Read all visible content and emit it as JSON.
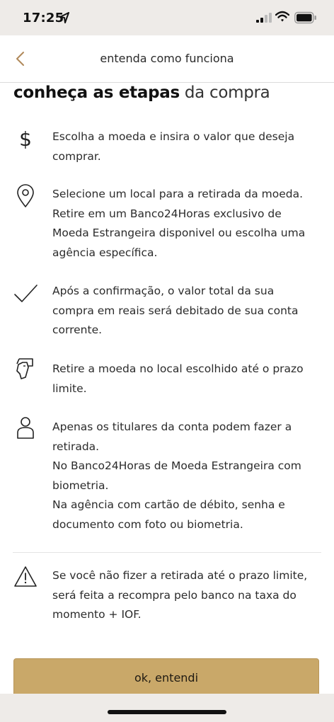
{
  "status_bar": {
    "time": "17:25"
  },
  "nav": {
    "title": "entenda como funciona"
  },
  "heading": {
    "bold": "conheça as etapas",
    "light": "da compra"
  },
  "steps": [
    {
      "icon": "dollar-icon",
      "lines": [
        "Escolha a moeda e insira o valor que deseja",
        "comprar."
      ]
    },
    {
      "icon": "location-pin-icon",
      "lines": [
        "Selecione um local para a retirada da moeda.",
        "Retire em um Banco24Horas exclusivo de",
        "Moeda Estrangeira disponivel ou escolha uma",
        "agência específica."
      ]
    },
    {
      "icon": "checkmark-icon",
      "lines": [
        "Após a confirmação, o valor total da sua",
        "compra em reais será debitado de sua conta",
        "corrente."
      ]
    },
    {
      "icon": "hand-cash-icon",
      "lines": [
        "Retire a moeda no local escolhido até o prazo",
        "limite."
      ]
    },
    {
      "icon": "person-icon",
      "lines": [
        "Apenas os titulares da conta podem fazer a",
        "retirada.",
        "No Banco24Horas de Moeda Estrangeira com",
        "biometria.",
        "Na agência com cartão de débito, senha e",
        "documento com foto ou biometria."
      ]
    }
  ],
  "warning": {
    "icon": "warning-icon",
    "lines": [
      "Se você não fizer a retirada até o prazo limite,",
      "será feita a recompra pelo banco na taxa do",
      "momento + IOF."
    ]
  },
  "cta": {
    "label": "ok, entendi"
  },
  "colors": {
    "accent": "#c9a869",
    "back_arrow": "#b0895a"
  }
}
